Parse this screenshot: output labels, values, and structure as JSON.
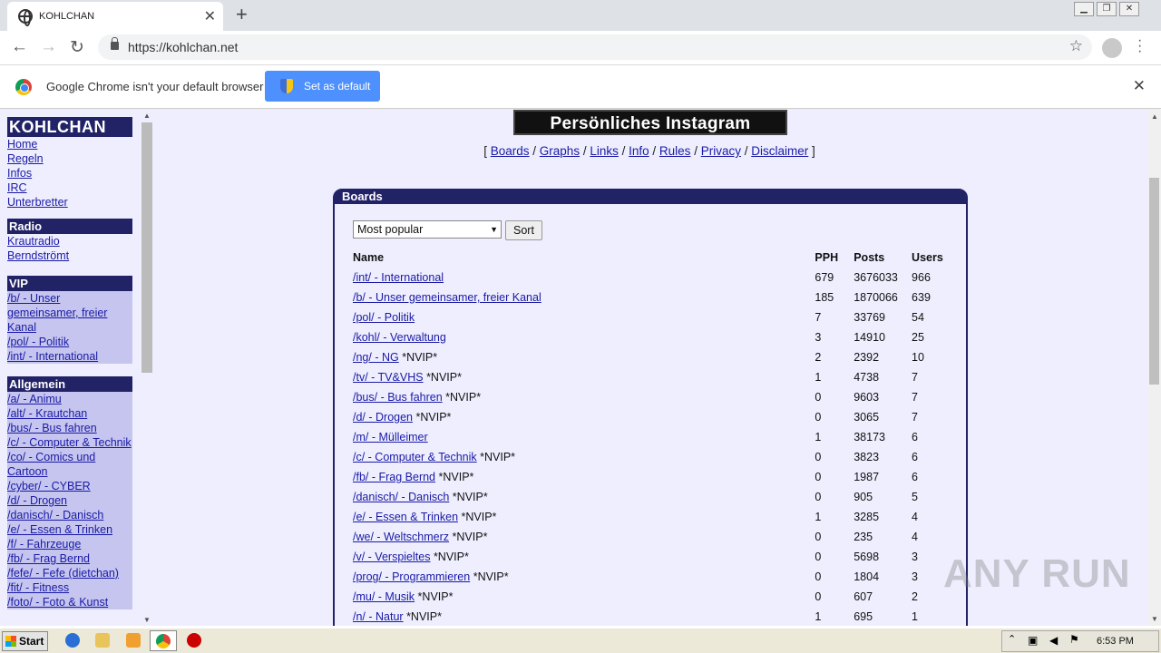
{
  "browser": {
    "tab_title": "KOHLCHAN",
    "url": "https://kohlchan.net",
    "infobar_text": "Google Chrome isn't your default browser",
    "set_default_label": "Set as default"
  },
  "sidebar": {
    "brand": "KOHLCHAN",
    "main_links": [
      "Home",
      "Regeln",
      "Infos",
      "IRC",
      "Unterbretter"
    ],
    "radio_title": "Radio",
    "radio_links": [
      "Krautradio",
      "Berndströmt"
    ],
    "vip_title": "VIP",
    "vip_links": [
      "/b/ - Unser gemeinsamer, freier Kanal",
      "/pol/ - Politik",
      "/int/ - International"
    ],
    "allgemein_title": "Allgemein",
    "allgemein_links": [
      "/a/ - Animu",
      "/alt/ - Krautchan",
      "/bus/ - Bus fahren",
      "/c/ - Computer & Technik",
      "/co/ - Comics und Cartoon",
      "/cyber/ - CYBER",
      "/d/ - Drogen",
      "/danisch/ - Danisch",
      "/e/ - Essen & Trinken",
      "/f/ - Fahrzeuge",
      "/fb/ - Frag Bernd",
      "/fefe/ - Fefe (dietchan)",
      "/fit/ - Fitness",
      "/foto/ - Foto & Kunst"
    ]
  },
  "page": {
    "banner_text": "Persönliches Instagram",
    "nav_links": [
      "Boards",
      "Graphs",
      "Links",
      "Info",
      "Rules",
      "Privacy",
      "Disclaimer"
    ]
  },
  "boards": {
    "title": "Boards",
    "sort_selected": "Most popular",
    "sort_button": "Sort",
    "columns": [
      "Name",
      "PPH",
      "Posts",
      "Users"
    ],
    "rows": [
      {
        "name": "/int/ - International",
        "tag": "",
        "pph": "679",
        "posts": "3676033",
        "users": "966"
      },
      {
        "name": "/b/ - Unser gemeinsamer, freier Kanal",
        "tag": "",
        "pph": "185",
        "posts": "1870066",
        "users": "639"
      },
      {
        "name": "/pol/ - Politik",
        "tag": "",
        "pph": "7",
        "posts": "33769",
        "users": "54"
      },
      {
        "name": "/kohl/ - Verwaltung",
        "tag": "",
        "pph": "3",
        "posts": "14910",
        "users": "25"
      },
      {
        "name": "/ng/ - NG",
        "tag": "*NVIP*",
        "pph": "2",
        "posts": "2392",
        "users": "10"
      },
      {
        "name": "/tv/ - TV&VHS",
        "tag": "*NVIP*",
        "pph": "1",
        "posts": "4738",
        "users": "7"
      },
      {
        "name": "/bus/ - Bus fahren",
        "tag": "*NVIP*",
        "pph": "0",
        "posts": "9603",
        "users": "7"
      },
      {
        "name": "/d/ - Drogen",
        "tag": "*NVIP*",
        "pph": "0",
        "posts": "3065",
        "users": "7"
      },
      {
        "name": "/m/ - Mülleimer",
        "tag": "",
        "pph": "1",
        "posts": "38173",
        "users": "6"
      },
      {
        "name": "/c/ - Computer & Technik",
        "tag": "*NVIP*",
        "pph": "0",
        "posts": "3823",
        "users": "6"
      },
      {
        "name": "/fb/ - Frag Bernd",
        "tag": "*NVIP*",
        "pph": "0",
        "posts": "1987",
        "users": "6"
      },
      {
        "name": "/danisch/ - Danisch",
        "tag": "*NVIP*",
        "pph": "0",
        "posts": "905",
        "users": "5"
      },
      {
        "name": "/e/ - Essen & Trinken",
        "tag": "*NVIP*",
        "pph": "1",
        "posts": "3285",
        "users": "4"
      },
      {
        "name": "/we/ - Weltschmerz",
        "tag": "*NVIP*",
        "pph": "0",
        "posts": "235",
        "users": "4"
      },
      {
        "name": "/v/ - Verspieltes",
        "tag": "*NVIP*",
        "pph": "0",
        "posts": "5698",
        "users": "3"
      },
      {
        "name": "/prog/ - Programmieren",
        "tag": "*NVIP*",
        "pph": "0",
        "posts": "1804",
        "users": "3"
      },
      {
        "name": "/mu/ - Musik",
        "tag": "*NVIP*",
        "pph": "0",
        "posts": "607",
        "users": "2"
      },
      {
        "name": "/n/ - Natur",
        "tag": "*NVIP*",
        "pph": "1",
        "posts": "695",
        "users": "1"
      }
    ]
  },
  "taskbar": {
    "start_label": "Start",
    "clock": "6:53 PM"
  },
  "watermark": "ANY RUN",
  "colors": {
    "accent": "#222266",
    "page_bg": "#eeeeff",
    "link": "#1a1aa6",
    "button_blue": "#4d90fe"
  }
}
